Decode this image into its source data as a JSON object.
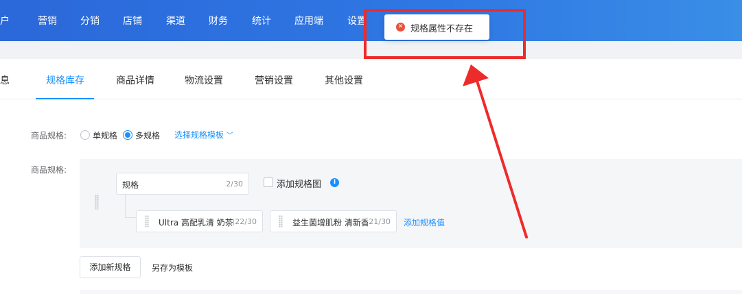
{
  "topnav": {
    "items": [
      "用户",
      "营销",
      "分销",
      "店铺",
      "渠道",
      "财务",
      "统计",
      "应用端",
      "设置"
    ]
  },
  "tabs": [
    "信息",
    "规格库存",
    "商品详情",
    "物流设置",
    "营销设置",
    "其他设置"
  ],
  "active_tab": "规格库存",
  "spec_type": {
    "label": "商品规格:",
    "options": [
      "单规格",
      "多规格"
    ],
    "selected": "多规格",
    "template_link": "选择规格模板"
  },
  "spec_edit": {
    "label": "商品规格:",
    "spec_name": {
      "value": "规格",
      "count": "2/30"
    },
    "add_image_label": "添加规格图",
    "values": [
      {
        "value": "Ultra 高配乳清 奶茶味",
        "count": "22/30"
      },
      {
        "value": "益生菌增肌粉 清新香",
        "count": "21/30"
      }
    ],
    "add_value_link": "添加规格值"
  },
  "actions": {
    "add_spec": "添加新规格",
    "save_template": "另存为模板"
  },
  "toast": {
    "message": "规格属性不存在",
    "icon": "error-icon"
  },
  "colors": {
    "accent": "#1890ff",
    "header": "#2f78e4",
    "annotation": "#ee2b2b",
    "error": "#e5533d"
  }
}
